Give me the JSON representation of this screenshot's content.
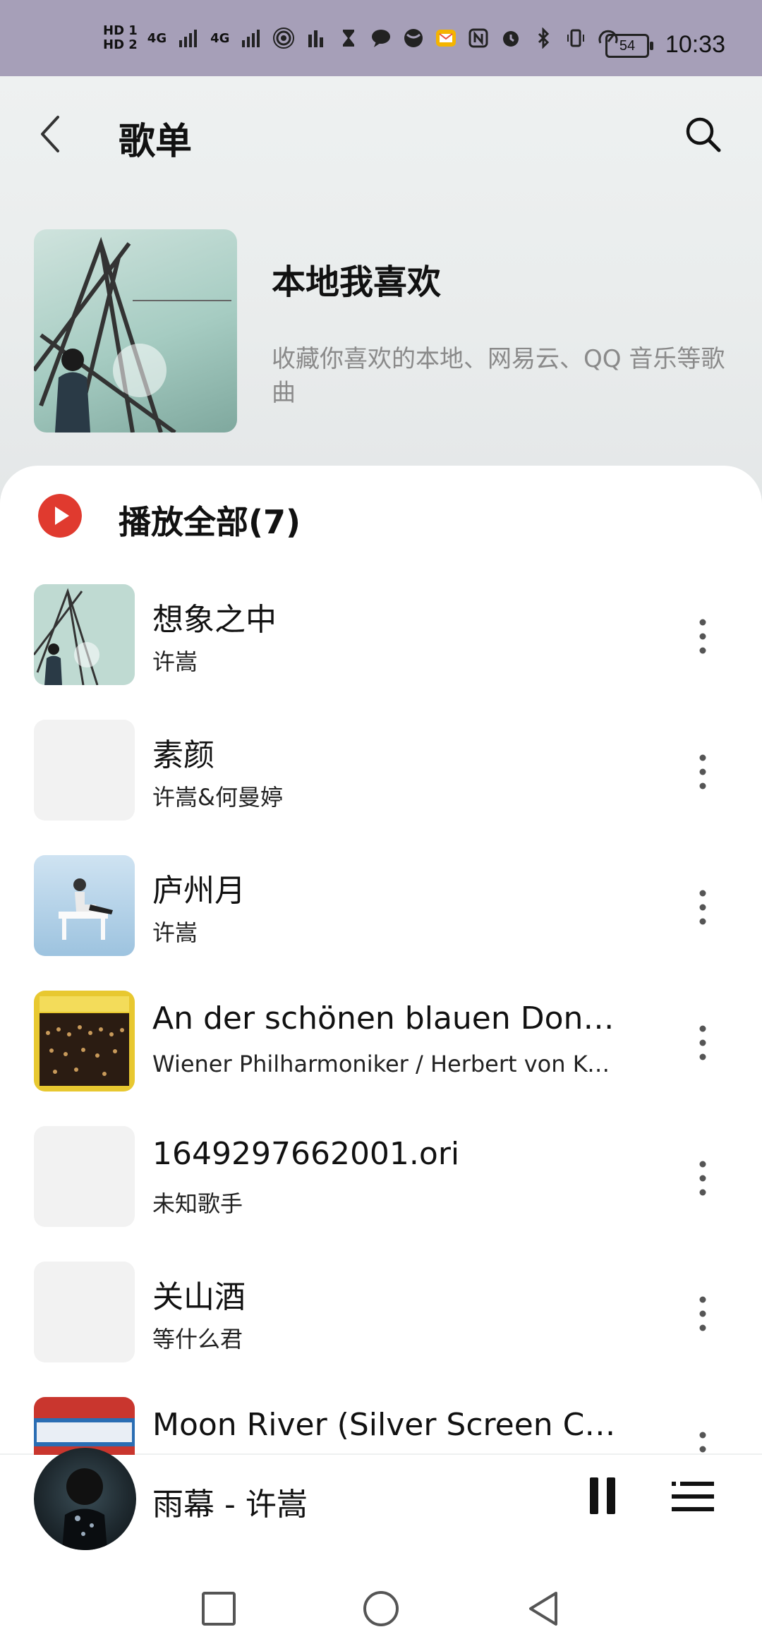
{
  "status_bar": {
    "hd1": "HD 1",
    "hd2": "HD 2",
    "signal1": "4G",
    "signal2": "4G",
    "battery": "54",
    "time": "10:33"
  },
  "header": {
    "title": "歌单"
  },
  "playlist": {
    "name": "本地我喜欢",
    "description": "收藏你喜欢的本地、网易云、QQ 音乐等歌曲"
  },
  "play_all": {
    "label": "播放全部(7)"
  },
  "songs": [
    {
      "title": "想象之中",
      "artist": "许嵩"
    },
    {
      "title": "素颜",
      "artist": "许嵩&何曼婷"
    },
    {
      "title": "庐州月",
      "artist": "许嵩"
    },
    {
      "title": "An der schönen blauen Dona…",
      "artist": "Wiener Philharmoniker / Herbert von Kar…"
    },
    {
      "title": "1649297662001.ori",
      "artist": "未知歌手"
    },
    {
      "title": "关山酒",
      "artist": "等什么君"
    },
    {
      "title": "Moon River (Silver Screen Cla…",
      "artist": ""
    }
  ],
  "mini_player": {
    "now_playing": "雨幕 - 许嵩"
  },
  "colors": {
    "status_bar": "#a69fb8",
    "play_accent": "#e03a2f"
  }
}
